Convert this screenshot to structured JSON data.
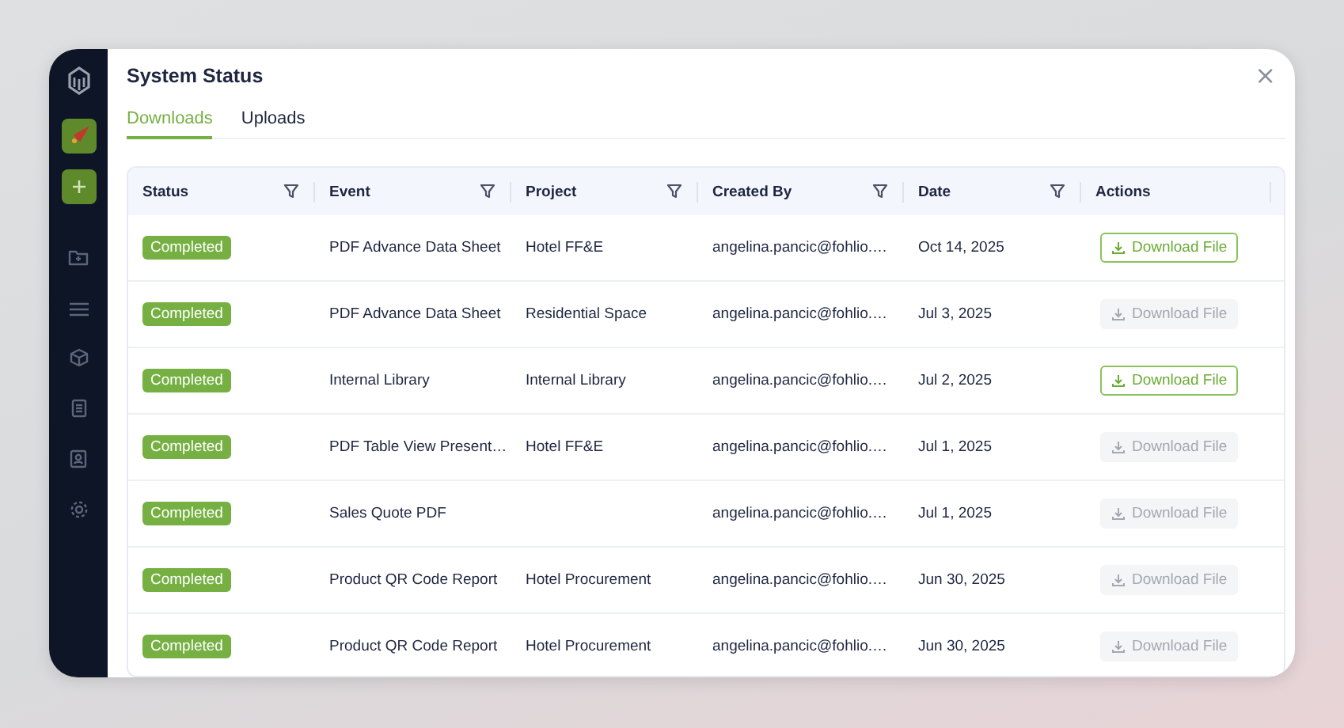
{
  "dialog": {
    "title": "System Status",
    "close": "×"
  },
  "tabs": [
    {
      "label": "Downloads",
      "selected": true
    },
    {
      "label": "Uploads",
      "selected": false
    }
  ],
  "table": {
    "columns": [
      {
        "label": "Status",
        "filter": true
      },
      {
        "label": "Event",
        "filter": true
      },
      {
        "label": "Project",
        "filter": true
      },
      {
        "label": "Created By",
        "filter": true
      },
      {
        "label": "Date",
        "filter": true
      },
      {
        "label": "Actions",
        "filter": false
      }
    ],
    "rows": [
      {
        "status": "Completed",
        "event": "PDF Advance Data Sheet",
        "project": "Hotel FF&E",
        "created_by": "angelina.pancic@fohlio.…",
        "date": "Oct 14, 2025",
        "action": {
          "label": "Download File",
          "disabled": false
        }
      },
      {
        "status": "Completed",
        "event": "PDF Advance Data Sheet",
        "project": "Residential Space",
        "created_by": "angelina.pancic@fohlio.…",
        "date": "Jul 3, 2025",
        "action": {
          "label": "Download File",
          "disabled": true
        }
      },
      {
        "status": "Completed",
        "event": "Internal Library",
        "project": "Internal Library",
        "created_by": "angelina.pancic@fohlio.…",
        "date": "Jul 2, 2025",
        "action": {
          "label": "Download File",
          "disabled": false
        }
      },
      {
        "status": "Completed",
        "event": "PDF Table View Present…",
        "project": "Hotel FF&E",
        "created_by": "angelina.pancic@fohlio.…",
        "date": "Jul 1, 2025",
        "action": {
          "label": "Download File",
          "disabled": true
        }
      },
      {
        "status": "Completed",
        "event": "Sales Quote PDF",
        "created_by": "angelina.pancic@fohlio.…",
        "date": "Jul 1, 2025",
        "action": {
          "label": "Download File",
          "disabled": true
        }
      },
      {
        "status": "Completed",
        "event": "Product QR Code Report",
        "project": "Hotel Procurement",
        "created_by": "angelina.pancic@fohlio.…",
        "date": "Jun 30, 2025",
        "action": {
          "label": "Download File",
          "disabled": true
        }
      },
      {
        "status": "Completed",
        "event": "Product QR Code Report",
        "project": "Hotel Procurement",
        "created_by": "angelina.pancic@fohlio.…",
        "date": "Jun 30, 2025",
        "action": {
          "label": "Download File",
          "disabled": true
        }
      }
    ]
  }
}
